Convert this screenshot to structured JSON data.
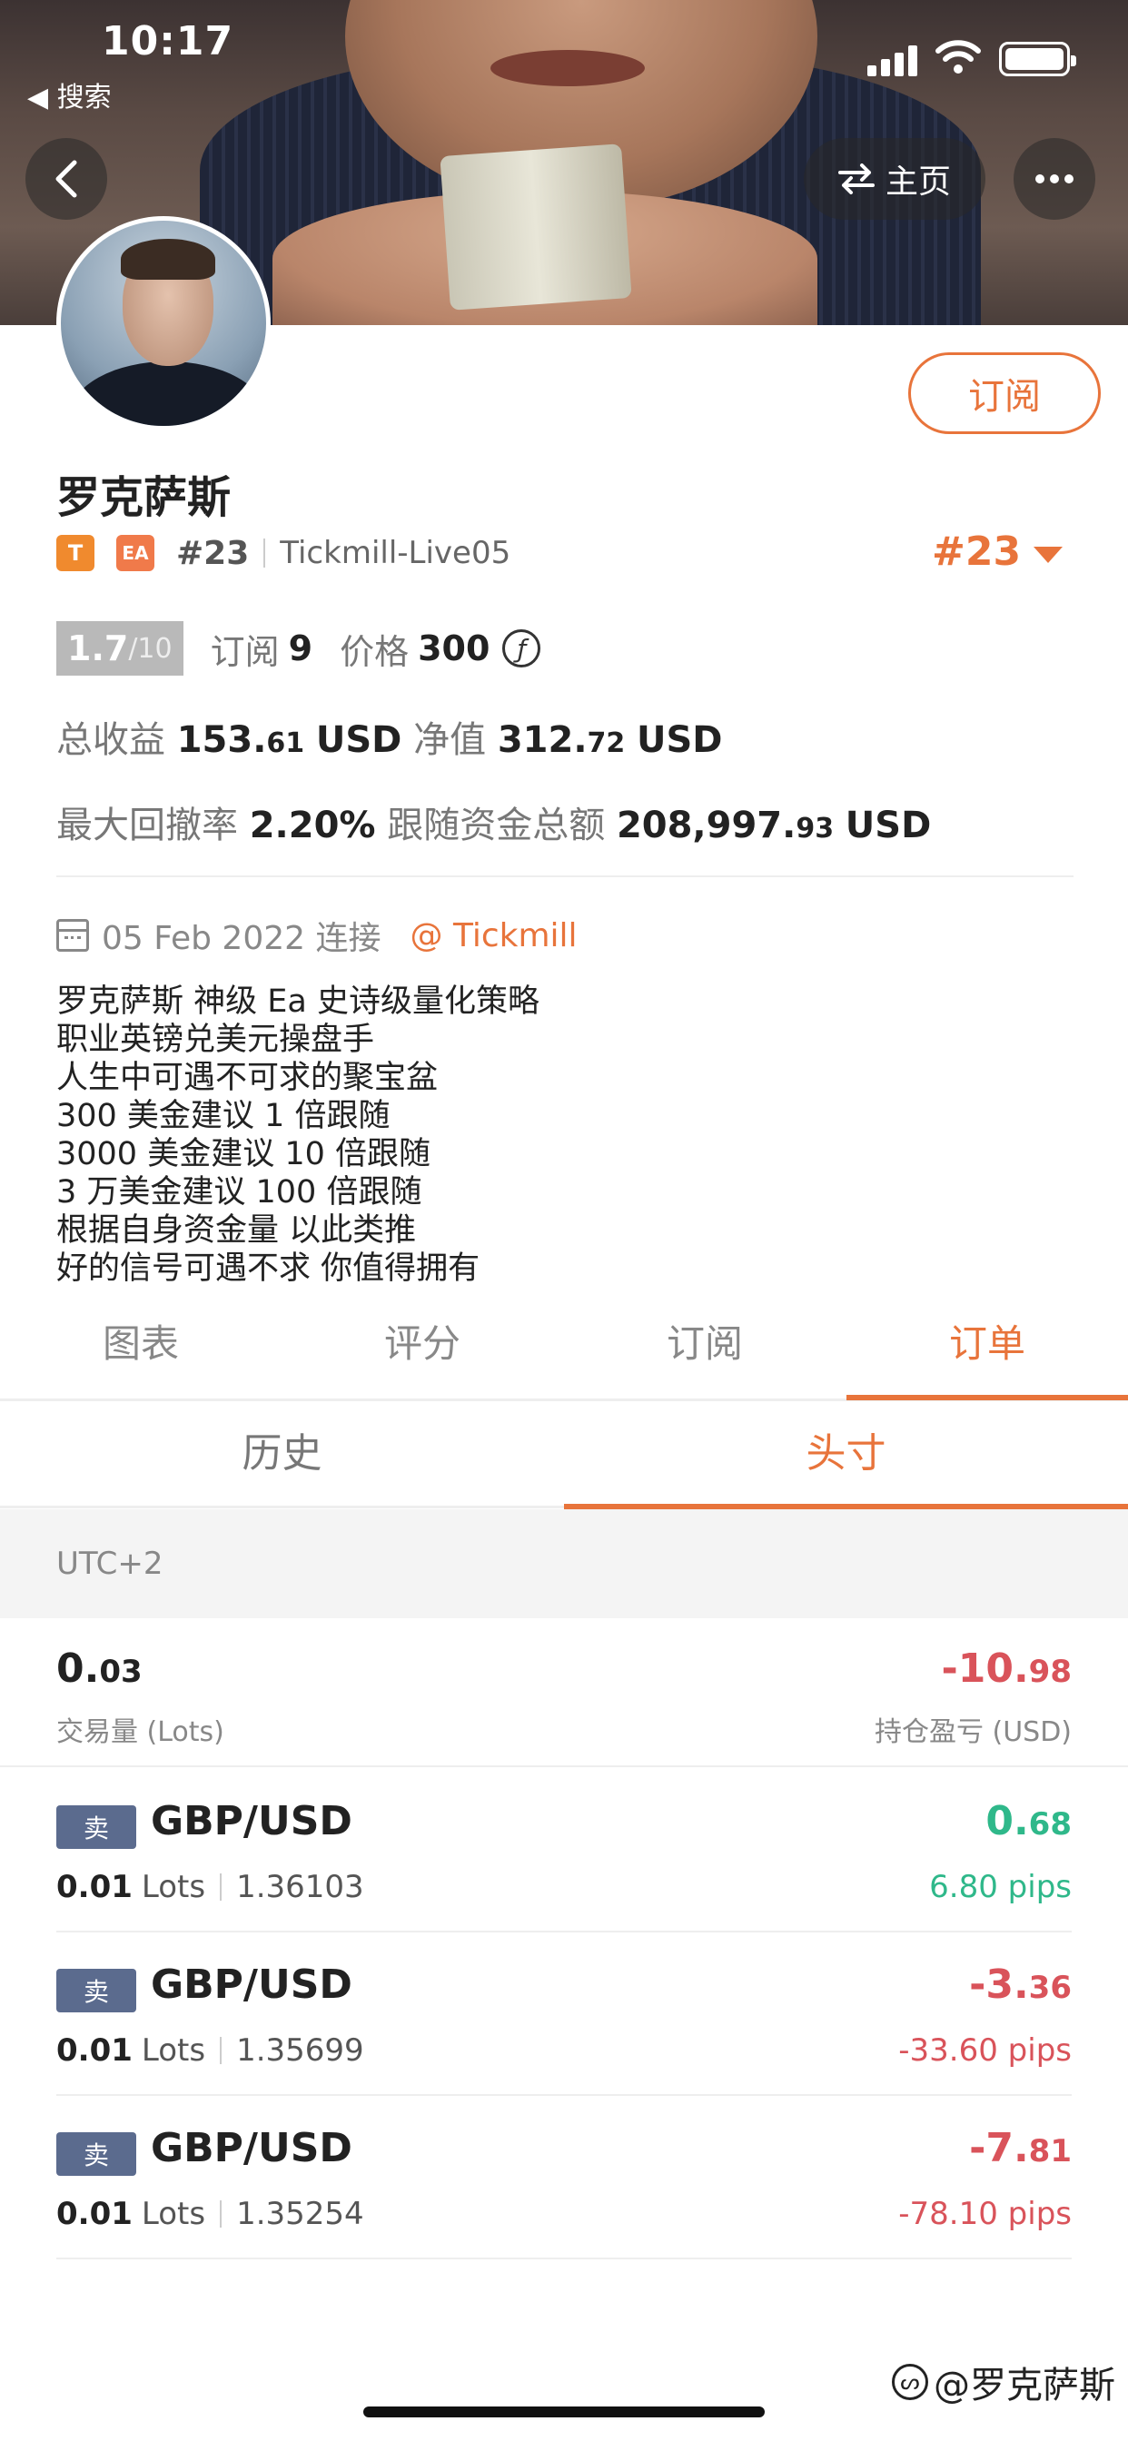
{
  "status_bar": {
    "time": "10:17",
    "back_label": "◀ 搜索"
  },
  "header": {
    "home_label": "主页",
    "subscribe_label": "订阅"
  },
  "profile": {
    "name": "罗克萨斯",
    "tag_t": "T",
    "tag_ea": "EA",
    "rank_small": "#23",
    "server": "Tickmill-Live05",
    "rank_big": "#23",
    "score": "1.7",
    "score_max": "/10",
    "subscribe_text": "订阅",
    "subscribe_count": "9",
    "price_text": "价格",
    "price_value": "300",
    "coin_symbol": "ƒ",
    "total_profit_label": "总收益",
    "total_profit_int": "153.",
    "total_profit_dec": "61",
    "total_profit_unit": "USD",
    "equity_label": "净值",
    "equity_int": "312.",
    "equity_dec": "72",
    "equity_unit": "USD",
    "drawdown_label": "最大回撤率",
    "drawdown_value": "2.20%",
    "follow_label": "跟随资金总额",
    "follow_int": "208,997.",
    "follow_dec": "93",
    "follow_unit": "USD",
    "connected_date": "05 Feb 2022 连接",
    "broker": "@ Tickmill",
    "description": [
      "罗克萨斯 神级 Ea 史诗级量化策略",
      "职业英镑兑美元操盘手",
      "人生中可遇不可求的聚宝盆",
      "300 美金建议 1 倍跟随",
      "3000 美金建议 10 倍跟随",
      "3 万美金建议 100 倍跟随",
      "根据自身资金量 以此类推",
      "好的信号可遇不求 你值得拥有"
    ]
  },
  "tabs": [
    "图表",
    "评分",
    "订阅",
    "订单"
  ],
  "active_tab": 3,
  "subtabs": [
    "历史",
    "头寸"
  ],
  "active_subtab": 1,
  "timezone": "UTC+2",
  "summary": {
    "volume_int": "0.",
    "volume_dec": "03",
    "volume_label": "交易量 (Lots)",
    "pl_int": "-10.",
    "pl_dec": "98",
    "pl_label": "持仓盈亏 (USD)"
  },
  "positions": [
    {
      "side": "卖",
      "symbol": "GBP/USD",
      "lots": "0.01",
      "lots_unit": "Lots",
      "price": "1.36103",
      "pnl_int": "0.",
      "pnl_dec": "68",
      "pips": "6.80 pips",
      "positive": true
    },
    {
      "side": "卖",
      "symbol": "GBP/USD",
      "lots": "0.01",
      "lots_unit": "Lots",
      "price": "1.35699",
      "pnl_int": "-3.",
      "pnl_dec": "36",
      "pips": "-33.60 pips",
      "positive": false
    },
    {
      "side": "卖",
      "symbol": "GBP/USD",
      "lots": "0.01",
      "lots_unit": "Lots",
      "price": "1.35254",
      "pnl_int": "-7.",
      "pnl_dec": "81",
      "pips": "-78.10 pips",
      "positive": false
    }
  ],
  "watermark": "@罗克萨斯",
  "colors": {
    "accent": "#e8743b",
    "profit": "#2fb88a",
    "loss": "#d9535a",
    "sell_badge": "#5b6b8e"
  }
}
